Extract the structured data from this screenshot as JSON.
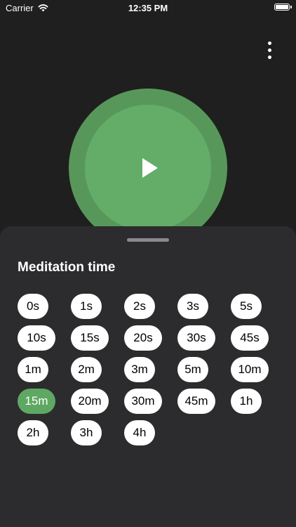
{
  "status_bar": {
    "carrier": "Carrier",
    "time": "12:35 PM"
  },
  "icons": {
    "wifi": "wifi-icon",
    "battery": "battery-icon",
    "more": "more-vertical-icon",
    "play": "play-icon"
  },
  "colors": {
    "background": "#1f1f1f",
    "sheet": "#2c2c2e",
    "accent": "#5fa863",
    "circle_outer": "#57985a",
    "circle_inner": "#64ad68"
  },
  "sheet": {
    "title": "Meditation time",
    "selected": "15m",
    "rows": [
      [
        "0s",
        "1s",
        "2s",
        "3s",
        "5s"
      ],
      [
        "10s",
        "15s",
        "20s",
        "30s",
        "45s"
      ],
      [
        "1m",
        "2m",
        "3m",
        "5m",
        "10m"
      ],
      [
        "15m",
        "20m",
        "30m",
        "45m",
        "1h"
      ],
      [
        "2h",
        "3h",
        "4h"
      ]
    ]
  }
}
